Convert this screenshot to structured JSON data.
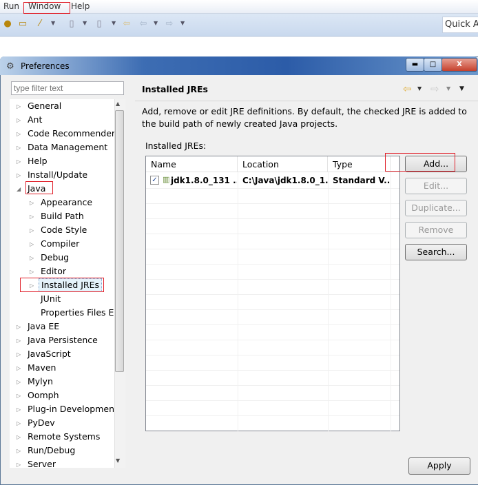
{
  "menubar": {
    "items": [
      "Run",
      "Window",
      "Help"
    ]
  },
  "toolbar": {
    "quick_access": "Quick Ac",
    "icons": [
      "new-project-icon",
      "open-icon",
      "wand-icon",
      "debug-icon",
      "run-icon",
      "back-icon",
      "nav-back-icon",
      "nav-forward-icon"
    ]
  },
  "dialog": {
    "title": "Preferences",
    "controls": [
      "minimize",
      "maximize",
      "close"
    ]
  },
  "filter": {
    "placeholder": "type filter text"
  },
  "tree": [
    {
      "label": "General",
      "level": 0,
      "expander": "collapsed"
    },
    {
      "label": "Ant",
      "level": 0,
      "expander": "collapsed"
    },
    {
      "label": "Code Recommenders",
      "level": 0,
      "expander": "collapsed"
    },
    {
      "label": "Data Management",
      "level": 0,
      "expander": "collapsed"
    },
    {
      "label": "Help",
      "level": 0,
      "expander": "collapsed"
    },
    {
      "label": "Install/Update",
      "level": 0,
      "expander": "collapsed"
    },
    {
      "label": "Java",
      "level": 0,
      "expander": "expanded"
    },
    {
      "label": "Appearance",
      "level": 1,
      "expander": "collapsed"
    },
    {
      "label": "Build Path",
      "level": 1,
      "expander": "collapsed"
    },
    {
      "label": "Code Style",
      "level": 1,
      "expander": "collapsed"
    },
    {
      "label": "Compiler",
      "level": 1,
      "expander": "collapsed"
    },
    {
      "label": "Debug",
      "level": 1,
      "expander": "collapsed"
    },
    {
      "label": "Editor",
      "level": 1,
      "expander": "collapsed"
    },
    {
      "label": "Installed JREs",
      "level": 1,
      "expander": "collapsed",
      "selected": true
    },
    {
      "label": "JUnit",
      "level": 1,
      "expander": "none"
    },
    {
      "label": "Properties Files Ed",
      "level": 1,
      "expander": "none"
    },
    {
      "label": "Java EE",
      "level": 0,
      "expander": "collapsed"
    },
    {
      "label": "Java Persistence",
      "level": 0,
      "expander": "collapsed"
    },
    {
      "label": "JavaScript",
      "level": 0,
      "expander": "collapsed"
    },
    {
      "label": "Maven",
      "level": 0,
      "expander": "collapsed"
    },
    {
      "label": "Mylyn",
      "level": 0,
      "expander": "collapsed"
    },
    {
      "label": "Oomph",
      "level": 0,
      "expander": "collapsed"
    },
    {
      "label": "Plug-in Development",
      "level": 0,
      "expander": "collapsed"
    },
    {
      "label": "PyDev",
      "level": 0,
      "expander": "collapsed"
    },
    {
      "label": "Remote Systems",
      "level": 0,
      "expander": "collapsed"
    },
    {
      "label": "Run/Debug",
      "level": 0,
      "expander": "collapsed"
    },
    {
      "label": "Server",
      "level": 0,
      "expander": "collapsed"
    }
  ],
  "page": {
    "title": "Installed JREs",
    "description": "Add, remove or edit JRE definitions. By default, the checked JRE is added to the build path of newly created Java projects.",
    "table_label": "Installed JREs:",
    "columns": [
      "Name",
      "Location",
      "Type"
    ],
    "rows": [
      {
        "checked": true,
        "name": "jdk1.8.0_131 ...",
        "location": "C:\\Java\\jdk1.8.0_1...",
        "type": "Standard V..."
      }
    ],
    "buttons": [
      {
        "label": "Add...",
        "enabled": true
      },
      {
        "label": "Edit...",
        "enabled": false
      },
      {
        "label": "Duplicate...",
        "enabled": false
      },
      {
        "label": "Remove",
        "enabled": false
      },
      {
        "label": "Search...",
        "enabled": true
      }
    ],
    "apply": "Apply"
  },
  "annotation_color": "#e0202a"
}
